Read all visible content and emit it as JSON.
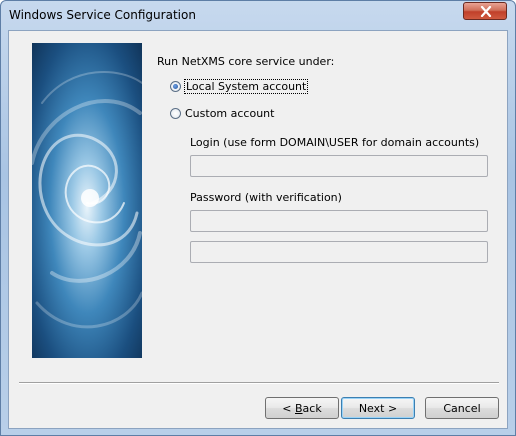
{
  "window": {
    "title": "Windows Service Configuration",
    "close_icon": "close-x-icon"
  },
  "content": {
    "prompt": "Run NetXMS core service under:",
    "options": [
      {
        "label": "Local System account",
        "selected": true,
        "focused": true
      },
      {
        "label": "Custom account",
        "selected": false,
        "focused": false
      }
    ],
    "login_label": "Login (use form DOMAIN\\USER for domain accounts)",
    "login_value": "",
    "password_label": "Password (with verification)",
    "password_value": "",
    "password_verify_value": "",
    "fields_enabled": false
  },
  "buttons": {
    "back": {
      "prefix": "< ",
      "accel": "B",
      "rest": "ack"
    },
    "next": "Next >",
    "cancel": "Cancel"
  },
  "side_image": "blue-swirl-graphic"
}
